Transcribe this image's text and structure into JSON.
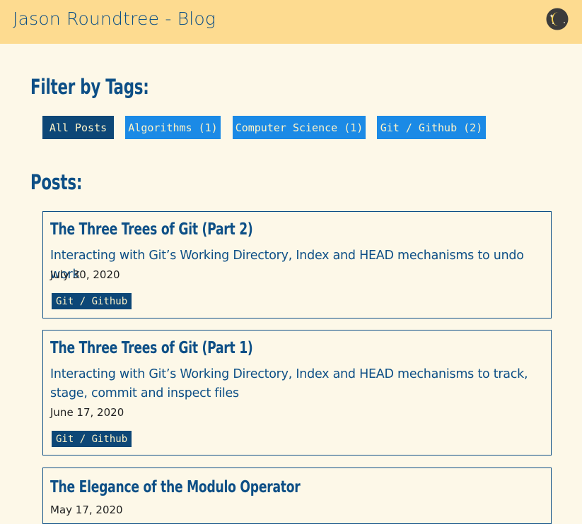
{
  "header": {
    "site_title": "Jason Roundtree - Blog",
    "theme_toggle_icon": "moon-stars-icon"
  },
  "filter": {
    "heading": "Filter by Tags:",
    "tags": [
      {
        "label": "All Posts",
        "active": true
      },
      {
        "label": "Algorithms (1)",
        "active": false
      },
      {
        "label": "Computer Science (1)",
        "active": false
      },
      {
        "label": "Git / Github (2)",
        "active": false
      }
    ]
  },
  "posts_section": {
    "heading": "Posts:",
    "posts": [
      {
        "title": "The Three Trees of Git (Part 2)",
        "description": "Interacting with Git’s Working Directory, Index and HEAD mechanisms to undo work",
        "date": "July 30, 2020",
        "tag": "Git / Github"
      },
      {
        "title": "The Three Trees of Git (Part 1)",
        "description": "Interacting with Git’s Working Directory, Index and HEAD mechanisms to track, stage, commit and inspect files",
        "date": "June 17, 2020",
        "tag": "Git / Github"
      },
      {
        "title": "The Elegance of the Modulo Operator",
        "date": "May 17, 2020"
      }
    ]
  },
  "colors": {
    "header_bg": "#fddb90",
    "page_bg": "#fdf8e8",
    "primary_text": "#0d4f86",
    "active_tag_bg": "#0d4777",
    "tag_bg": "#1b8ae6",
    "tag_text": "#fdf3c8"
  }
}
